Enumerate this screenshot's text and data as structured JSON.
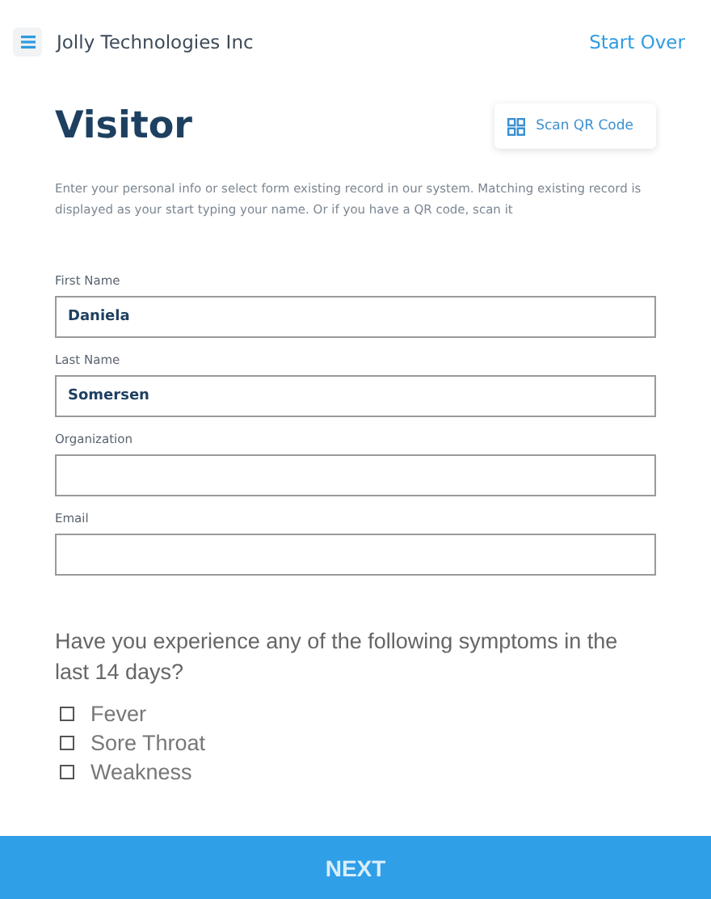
{
  "header": {
    "company": "Jolly Technologies Inc",
    "start_over": "Start Over"
  },
  "title": "Visitor",
  "scan_button": "Scan QR Code",
  "description": "Enter your personal info or select form existing record in our system. Matching existing record is displayed as your start typing your name. Or if you have a QR code, scan it",
  "fields": [
    {
      "label": "First Name",
      "value": "Daniela"
    },
    {
      "label": "Last Name",
      "value": "Somersen"
    },
    {
      "label": "Organization"
    },
    {
      "label": "Email"
    }
  ],
  "question": "Have you experience any of the following symptoms in the last 14 days?",
  "symptoms": [
    {
      "label": "Fever",
      "checked": false
    },
    {
      "label": "Sore Throat",
      "checked": false
    },
    {
      "label": "Weakness",
      "checked": false
    }
  ],
  "next_button": {
    "label": "NEXT",
    "disabled": true
  }
}
